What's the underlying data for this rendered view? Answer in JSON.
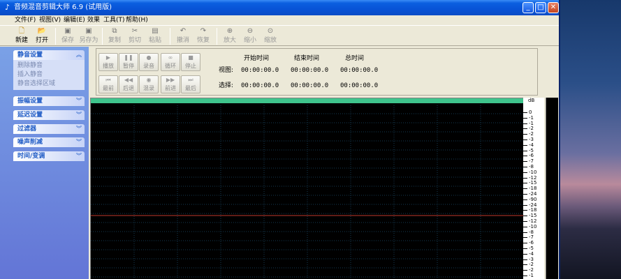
{
  "window": {
    "title": "音频混音剪辑大师 6.9 (试用版)",
    "controls": {
      "minimize": "_",
      "maximize": "□",
      "close": "✕"
    }
  },
  "menu": [
    "文件(F)",
    "视图(V)",
    "编辑(E)",
    "效果",
    "工具(T)",
    "帮助(H)"
  ],
  "toolbar": [
    {
      "label": "新建",
      "icon": "new-file-icon",
      "enabled": true
    },
    {
      "label": "打开",
      "icon": "open-folder-icon",
      "enabled": true
    },
    {
      "label": "保存",
      "icon": "save-icon",
      "enabled": false
    },
    {
      "label": "另存为",
      "icon": "save-as-icon",
      "enabled": false
    },
    {
      "label": "复制",
      "icon": "copy-icon",
      "enabled": false
    },
    {
      "label": "剪切",
      "icon": "cut-icon",
      "enabled": false
    },
    {
      "label": "粘贴",
      "icon": "paste-icon",
      "enabled": false
    },
    {
      "label": "撤消",
      "icon": "undo-icon",
      "enabled": false
    },
    {
      "label": "恢复",
      "icon": "redo-icon",
      "enabled": false
    },
    {
      "label": "放大",
      "icon": "zoom-in-icon",
      "enabled": false
    },
    {
      "label": "缩小",
      "icon": "zoom-out-icon",
      "enabled": false
    },
    {
      "label": "缩放",
      "icon": "zoom-fit-icon",
      "enabled": false
    }
  ],
  "taskpane": {
    "groups": [
      {
        "title": "静音设置",
        "expanded": true,
        "links": [
          "删除静音",
          "插入静音",
          "静音选择区域"
        ]
      },
      {
        "title": "振幅设置",
        "expanded": false,
        "links": []
      },
      {
        "title": "延迟设置",
        "expanded": false,
        "links": []
      },
      {
        "title": "过滤器",
        "expanded": false,
        "links": []
      },
      {
        "title": "噪声削减",
        "expanded": false,
        "links": []
      },
      {
        "title": "时间/变调",
        "expanded": false,
        "links": []
      }
    ]
  },
  "transport": {
    "row1": [
      {
        "label": "播放",
        "icon": "play-icon"
      },
      {
        "label": "暂停",
        "icon": "pause-icon"
      },
      {
        "label": "录音",
        "icon": "record-icon"
      },
      {
        "label": "循环",
        "icon": "loop-icon"
      },
      {
        "label": "停止",
        "icon": "stop-icon"
      }
    ],
    "row2": [
      {
        "label": "最前",
        "icon": "skip-to-start-icon"
      },
      {
        "label": "后退",
        "icon": "rewind-icon"
      },
      {
        "label": "混录",
        "icon": "mix-record-icon"
      },
      {
        "label": "前进",
        "icon": "fast-forward-icon"
      },
      {
        "label": "最后",
        "icon": "skip-to-end-icon"
      }
    ]
  },
  "times": {
    "headers": [
      "开始时间",
      "结束时间",
      "总时间"
    ],
    "rows": [
      {
        "label": "视图:",
        "values": [
          "00:00:00.0",
          "00:00:00.0",
          "00:00:00.0"
        ]
      },
      {
        "label": "选择:",
        "values": [
          "00:00:00.0",
          "00:00:00.0",
          "00:00:00.0"
        ]
      }
    ]
  },
  "scale": {
    "unit": "dB",
    "labels": [
      "0",
      "-1",
      "-1",
      "-2",
      "-2",
      "-3",
      "-4",
      "-5",
      "-6",
      "-7",
      "-8",
      "-10",
      "-12",
      "-15",
      "-18",
      "-24",
      "-90",
      "-24",
      "-18",
      "-15",
      "-12",
      "-10",
      "-8",
      "-7",
      "-6",
      "-5",
      "-4",
      "-3",
      "-2",
      "-2",
      "-1",
      "-1"
    ]
  },
  "colors": {
    "grid": "#143a52",
    "centerline": "#c0392b",
    "overview": "#3fc48c"
  }
}
